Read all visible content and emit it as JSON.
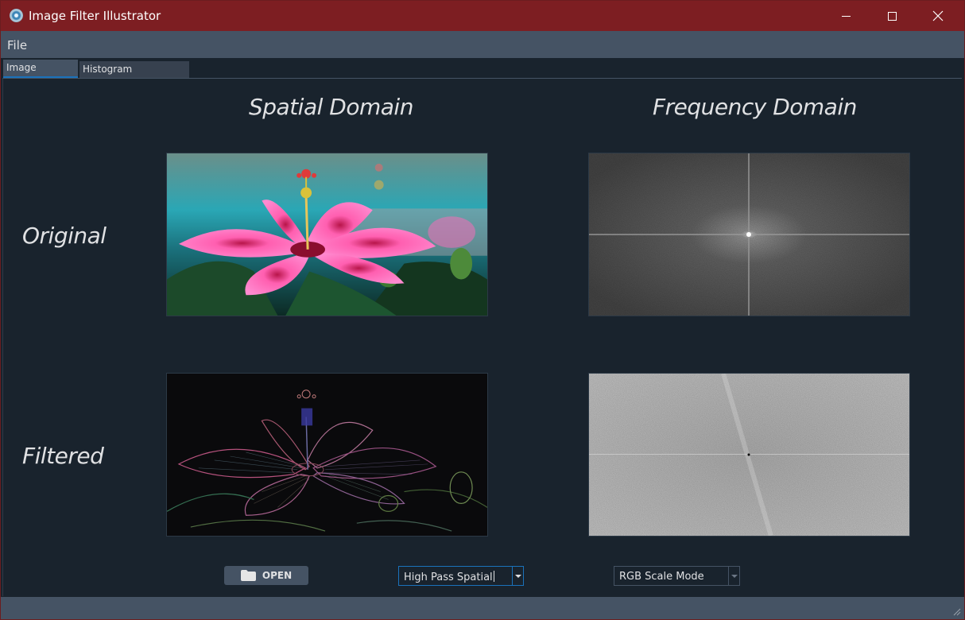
{
  "window": {
    "title": "Image Filter Illustrator",
    "colors": {
      "titlebar": "#7d1e22",
      "background": "#19232d",
      "accent": "#1a72bb",
      "chrome": "#455364"
    }
  },
  "menu": {
    "file": "File"
  },
  "tabs": [
    {
      "label": "Image Filtering",
      "active": true
    },
    {
      "label": "Histogram Equalization",
      "active": false
    }
  ],
  "headings": {
    "spatial": "Spatial Domain",
    "frequency": "Frequency Domain",
    "original": "Original",
    "filtered": "Filtered"
  },
  "images": {
    "original_spatial": "pink hibiscus flower photo",
    "original_frequency": "fourier spectrum magnitude",
    "filtered_spatial": "high-pass edge image of hibiscus",
    "filtered_frequency": "high-pass filtered spectrum"
  },
  "controls": {
    "open_label": "OPEN",
    "open_icon": "folder-icon",
    "filter_value": "High Pass Spatial",
    "mode_value": "RGB Scale Mode"
  }
}
